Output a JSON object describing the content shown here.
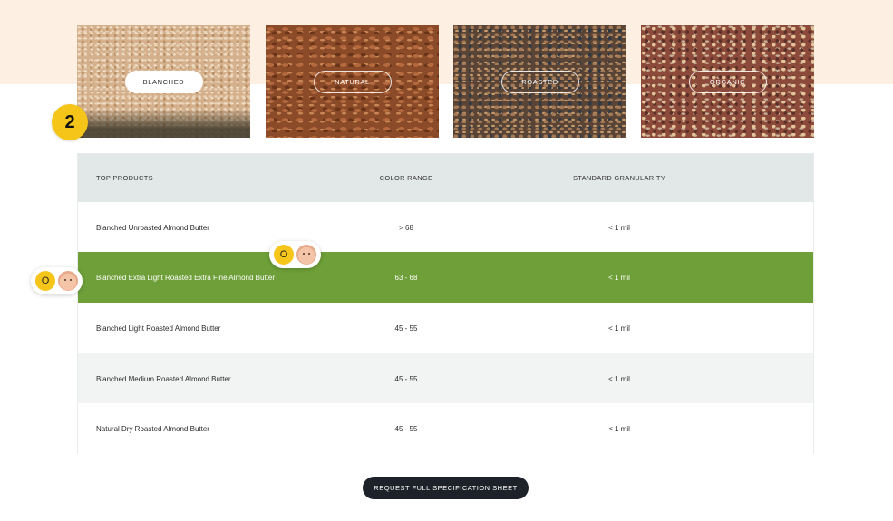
{
  "categories": [
    {
      "label": "BLANCHED",
      "active": true
    },
    {
      "label": "NATURAL",
      "active": false
    },
    {
      "label": "ROASTED",
      "active": false
    },
    {
      "label": "ORGANIC",
      "active": false
    }
  ],
  "step_number": "2",
  "table": {
    "headers": [
      "TOP PRODUCTS",
      "COLOR RANGE",
      "STANDARD GRANULARITY"
    ],
    "rows": [
      {
        "product": "Blanched Unroasted Almond Butter",
        "color_range": "> 68",
        "granularity": "< 1 mil"
      },
      {
        "product": "Blanched Extra Light Roasted Extra Fine Almond Butter",
        "color_range": "63 - 68",
        "granularity": "< 1 mil",
        "highlighted": true
      },
      {
        "product": "Blanched Light Roasted Almond Butter",
        "color_range": "45 - 55",
        "granularity": "< 1 mil"
      },
      {
        "product": "Blanched Medium Roasted Almond Butter",
        "color_range": "45 - 55",
        "granularity": "< 1 mil"
      },
      {
        "product": "Natural Dry Roasted Almond Butter",
        "color_range": "45 - 55",
        "granularity": "< 1 mil"
      }
    ]
  },
  "comments": [
    {
      "initial": "O"
    },
    {
      "initial": "O"
    }
  ],
  "cta_label": "REQUEST FULL SPECIFICATION SHEET",
  "colors": {
    "top_band": "#fdf0e3",
    "highlight_row": "#6e9f38",
    "header_row": "#e2e7e7",
    "badge": "#f5c51a",
    "cta": "#1d222a"
  }
}
